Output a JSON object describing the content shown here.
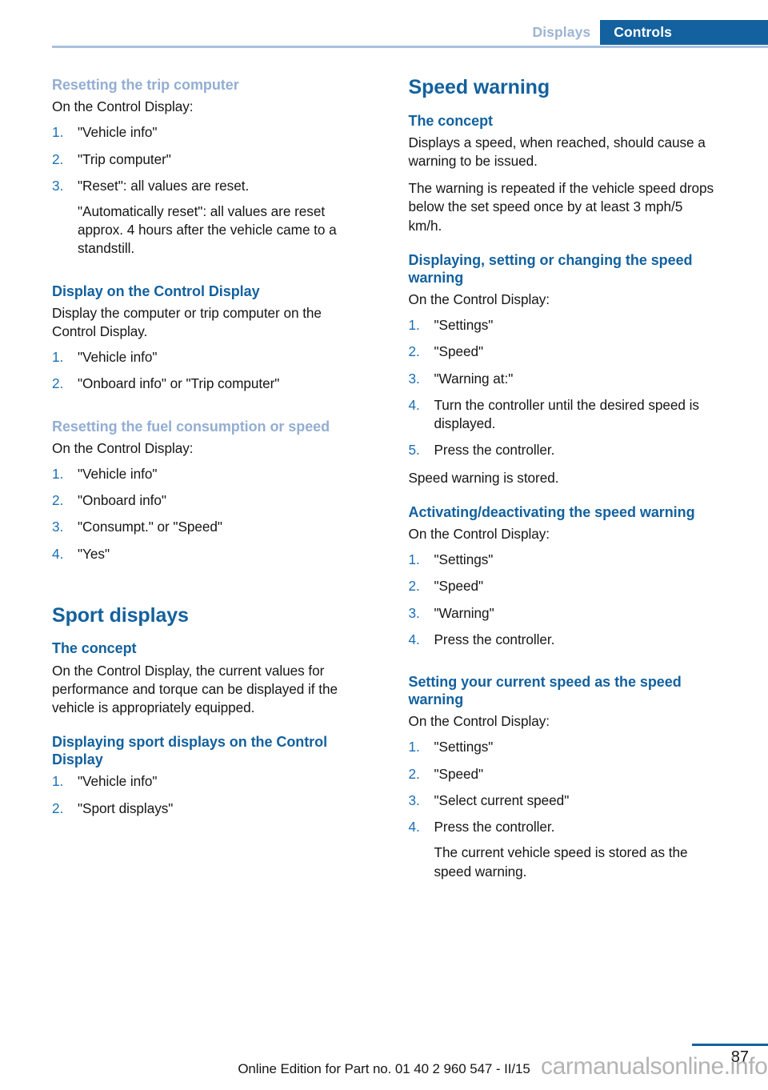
{
  "header": {
    "tab_inactive": "Displays",
    "tab_active": "Controls",
    "accent_blue": "#13619e",
    "muted_blue": "#93aed2",
    "rule_blue": "#a9c0de"
  },
  "left_column": {
    "section1": {
      "heading": "Resetting the trip computer",
      "heading_style": "muted",
      "intro": "On the Control Display:",
      "steps": [
        "\"Vehicle info\"",
        "\"Trip computer\"",
        "\"Reset\": all values are reset."
      ],
      "step3_substep": "\"Automatically reset\": all values are reset approx. 4 hours after the vehicle came to a standstill."
    },
    "section2": {
      "heading": "Display on the Control Display",
      "heading_style": "normal",
      "intro": "Display the computer or trip computer on the Control Display.",
      "steps": [
        "\"Vehicle info\"",
        "\"Onboard info\" or \"Trip computer\""
      ]
    },
    "section3": {
      "heading": "Resetting the fuel consumption or speed",
      "heading_style": "muted",
      "intro": "On the Control Display:",
      "steps": [
        "\"Vehicle info\"",
        "\"Onboard info\"",
        "\"Consumpt.\" or \"Speed\"",
        "\"Yes\""
      ]
    },
    "section4": {
      "title": "Sport displays",
      "concept_heading": "The concept",
      "concept_text": "On the Control Display, the current values for performance and torque can be displayed if the vehicle is appropriately equipped.",
      "display_heading": "Displaying sport displays on the Control Display",
      "display_steps": [
        "\"Vehicle info\"",
        "\"Sport displays\""
      ]
    }
  },
  "right_column": {
    "title": "Speed warning",
    "concept": {
      "heading": "The concept",
      "paragraph1": "Displays a speed, when reached, should cause a warning to be issued.",
      "paragraph2": "The warning is repeated if the vehicle speed drops below the set speed once by at least 3 mph/5 km/h."
    },
    "section_setting": {
      "heading": "Displaying, setting or changing the speed warning",
      "intro": "On the Control Display:",
      "steps": [
        "\"Settings\"",
        "\"Speed\"",
        "\"Warning at:\"",
        "Turn the controller until the desired speed is displayed.",
        "Press the controller."
      ],
      "outro": "Speed warning is stored."
    },
    "section_activating": {
      "heading": "Activating/deactivating the speed warning",
      "intro": "On the Control Display:",
      "steps": [
        "\"Settings\"",
        "\"Speed\"",
        "\"Warning\"",
        "Press the controller."
      ]
    },
    "section_current": {
      "heading": "Setting your current speed as the speed warning",
      "intro": "On the Control Display:",
      "steps": [
        "\"Settings\"",
        "\"Speed\"",
        "\"Select current speed\"",
        "Press the controller."
      ],
      "step4_substep": "The current vehicle speed is stored as the speed warning."
    }
  },
  "footer": {
    "page_number": "87",
    "note": "Online Edition for Part no. 01 40 2 960 547 - II/15",
    "watermark": "carmanualsonline.info"
  }
}
